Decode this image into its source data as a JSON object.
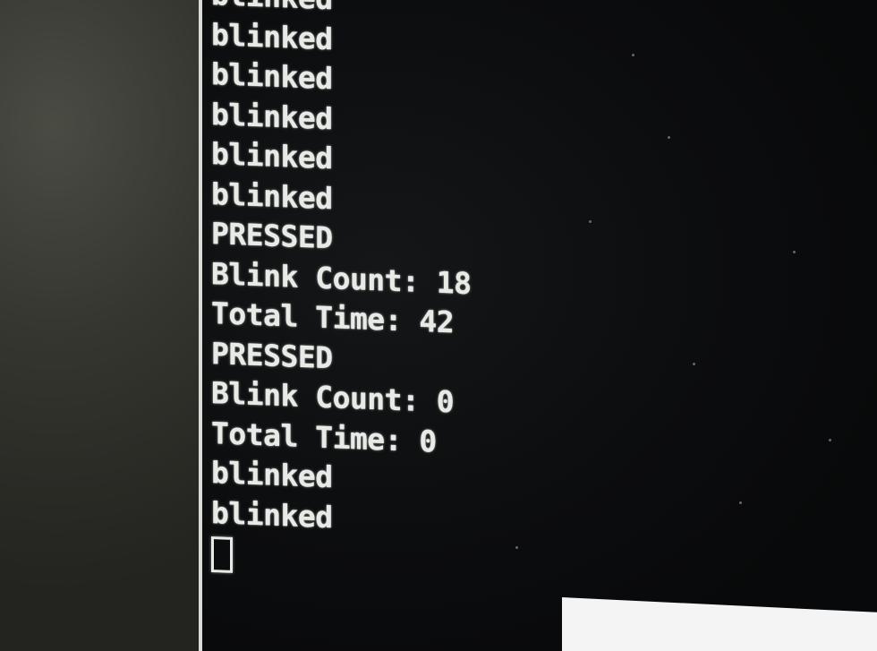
{
  "terminal": {
    "lines": [
      "blinked",
      "blinked",
      "blinked",
      "blinked",
      "blinked",
      "blinked",
      "PRESSED",
      "Blink Count: 18",
      "Total Time: 42",
      "PRESSED",
      "Blink Count: 0",
      "Total Time: 0",
      "blinked",
      "blinked"
    ]
  },
  "colors": {
    "terminal_bg": "#0c0d0f",
    "text": "#e8eae6"
  }
}
